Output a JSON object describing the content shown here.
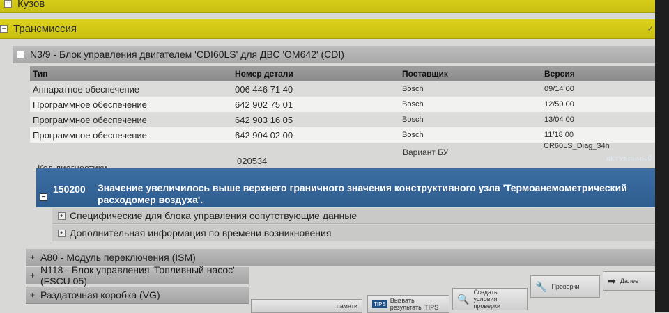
{
  "sections": {
    "kuzov": "Кузов",
    "transmission": "Трансмиссия"
  },
  "ecu": {
    "title": "N3/9 - Блок управления двигателем 'CDI60LS' для ДВС 'OM642' (CDI)",
    "headers": {
      "type": "Тип",
      "part": "Номер детали",
      "supplier": "Поставщик",
      "version": "Версия"
    },
    "rows": [
      {
        "type": "Аппаратное обеспечение",
        "part": "006 446 71 40",
        "supplier": "Bosch",
        "version": "09/14 00"
      },
      {
        "type": "Программное обеспечение",
        "part": "642 902 75 01",
        "supplier": "Bosch",
        "version": "12/50 00"
      },
      {
        "type": "Программное обеспечение",
        "part": "642 903 16 05",
        "supplier": "Bosch",
        "version": "13/04 00"
      },
      {
        "type": "Программное обеспечение",
        "part": "642 904 02 00",
        "supplier": "Bosch",
        "version": "11/18 00"
      }
    ],
    "variant_label": "Вариант БУ",
    "variant_value": "CR60LS_Diag_34h",
    "diag_label": "Код диагностики",
    "diag_value": "020534"
  },
  "fault": {
    "status": "АКТУАЛЬНЫЙ",
    "code": "150200",
    "text": "Значение увеличилось выше верхнего граничного значения конструктивного узла 'Термоанемометрический расходомер воздуха'."
  },
  "subsections": [
    "Специфические для блока управления сопутствующие данные",
    "Дополнительная информация по времени возникновения"
  ],
  "modules": [
    "A80 - Модуль переключения (ISM)",
    "N118 - Блок управления 'Топливный насос' (FSCU 05)",
    "Раздаточная коробка (VG)"
  ],
  "buttons": {
    "memory": "памяти",
    "tips_badge": "TIPS",
    "tips": "Вызвать результаты TIPS",
    "create_check": "Создать условия проверки",
    "checks": "Проверки",
    "next": "Далее"
  }
}
